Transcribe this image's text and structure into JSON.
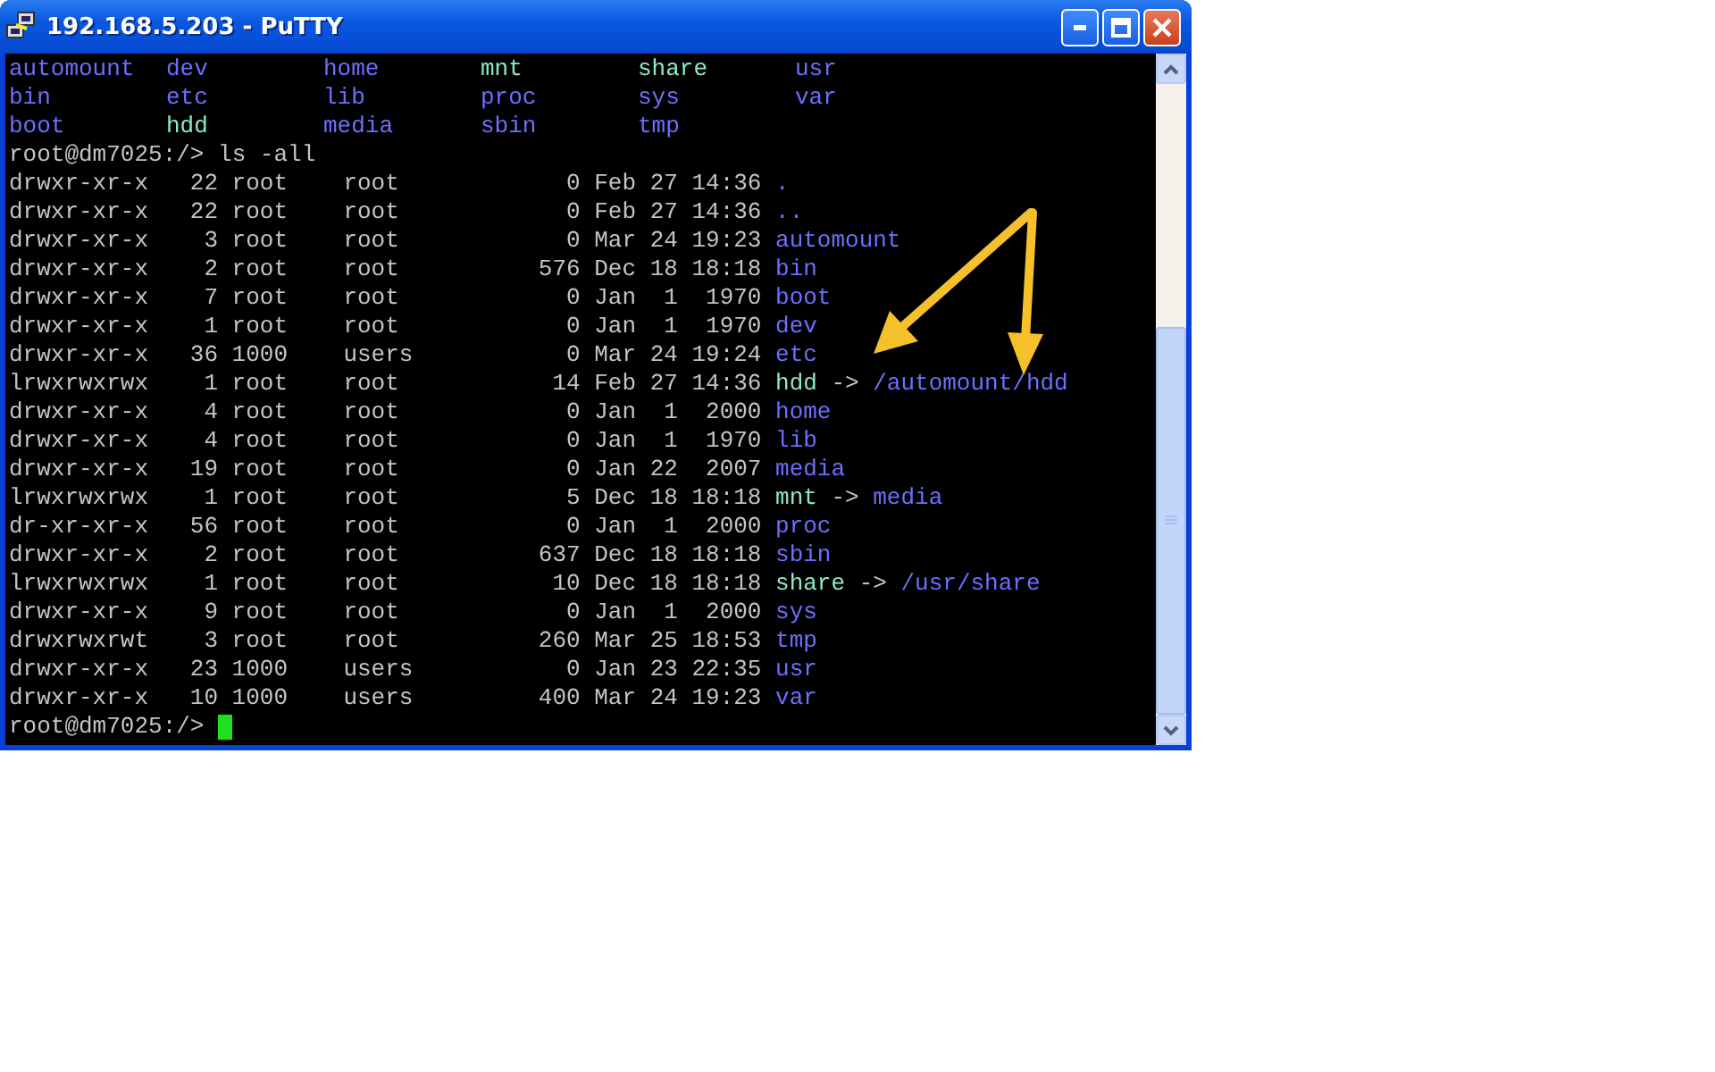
{
  "window": {
    "title": "192.168.5.203 - PuTTY"
  },
  "listing": [
    {
      "name": "automount",
      "kind": "dir"
    },
    {
      "name": "dev",
      "kind": "dir"
    },
    {
      "name": "home",
      "kind": "dir"
    },
    {
      "name": "mnt",
      "kind": "link"
    },
    {
      "name": "share",
      "kind": "link"
    },
    {
      "name": "usr",
      "kind": "dir"
    },
    {
      "name": "bin",
      "kind": "dir"
    },
    {
      "name": "etc",
      "kind": "dir"
    },
    {
      "name": "lib",
      "kind": "dir"
    },
    {
      "name": "proc",
      "kind": "dir"
    },
    {
      "name": "sys",
      "kind": "dir"
    },
    {
      "name": "var",
      "kind": "dir"
    },
    {
      "name": "boot",
      "kind": "dir"
    },
    {
      "name": "hdd",
      "kind": "link"
    },
    {
      "name": "media",
      "kind": "dir"
    },
    {
      "name": "sbin",
      "kind": "dir"
    },
    {
      "name": "tmp",
      "kind": "dir"
    }
  ],
  "command": {
    "prompt": "root@dm7025:/>",
    "text": "ls -all"
  },
  "entries": [
    {
      "perms": "drwxr-xr-x",
      "links": "22",
      "owner": "root",
      "group": "root",
      "size": "0",
      "date": "Feb 27 14:36",
      "name": ".",
      "kind": "dir"
    },
    {
      "perms": "drwxr-xr-x",
      "links": "22",
      "owner": "root",
      "group": "root",
      "size": "0",
      "date": "Feb 27 14:36",
      "name": "..",
      "kind": "dir"
    },
    {
      "perms": "drwxr-xr-x",
      "links": "3",
      "owner": "root",
      "group": "root",
      "size": "0",
      "date": "Mar 24 19:23",
      "name": "automount",
      "kind": "dir"
    },
    {
      "perms": "drwxr-xr-x",
      "links": "2",
      "owner": "root",
      "group": "root",
      "size": "576",
      "date": "Dec 18 18:18",
      "name": "bin",
      "kind": "dir"
    },
    {
      "perms": "drwxr-xr-x",
      "links": "7",
      "owner": "root",
      "group": "root",
      "size": "0",
      "date": "Jan  1  1970",
      "name": "boot",
      "kind": "dir"
    },
    {
      "perms": "drwxr-xr-x",
      "links": "1",
      "owner": "root",
      "group": "root",
      "size": "0",
      "date": "Jan  1  1970",
      "name": "dev",
      "kind": "dir"
    },
    {
      "perms": "drwxr-xr-x",
      "links": "36",
      "owner": "1000",
      "group": "users",
      "size": "0",
      "date": "Mar 24 19:24",
      "name": "etc",
      "kind": "dir"
    },
    {
      "perms": "lrwxrwxrwx",
      "links": "1",
      "owner": "root",
      "group": "root",
      "size": "14",
      "date": "Feb 27 14:36",
      "name": "hdd",
      "kind": "link",
      "arrow": "->",
      "target": "/automount/hdd"
    },
    {
      "perms": "drwxr-xr-x",
      "links": "4",
      "owner": "root",
      "group": "root",
      "size": "0",
      "date": "Jan  1  2000",
      "name": "home",
      "kind": "dir"
    },
    {
      "perms": "drwxr-xr-x",
      "links": "4",
      "owner": "root",
      "group": "root",
      "size": "0",
      "date": "Jan  1  1970",
      "name": "lib",
      "kind": "dir"
    },
    {
      "perms": "drwxr-xr-x",
      "links": "19",
      "owner": "root",
      "group": "root",
      "size": "0",
      "date": "Jan 22  2007",
      "name": "media",
      "kind": "dir"
    },
    {
      "perms": "lrwxrwxrwx",
      "links": "1",
      "owner": "root",
      "group": "root",
      "size": "5",
      "date": "Dec 18 18:18",
      "name": "mnt",
      "kind": "link",
      "arrow": "->",
      "target": "media"
    },
    {
      "perms": "dr-xr-xr-x",
      "links": "56",
      "owner": "root",
      "group": "root",
      "size": "0",
      "date": "Jan  1  2000",
      "name": "proc",
      "kind": "dir"
    },
    {
      "perms": "drwxr-xr-x",
      "links": "2",
      "owner": "root",
      "group": "root",
      "size": "637",
      "date": "Dec 18 18:18",
      "name": "sbin",
      "kind": "dir"
    },
    {
      "perms": "lrwxrwxrwx",
      "links": "1",
      "owner": "root",
      "group": "root",
      "size": "10",
      "date": "Dec 18 18:18",
      "name": "share",
      "kind": "link",
      "arrow": "->",
      "target": "/usr/share"
    },
    {
      "perms": "drwxr-xr-x",
      "links": "9",
      "owner": "root",
      "group": "root",
      "size": "0",
      "date": "Jan  1  2000",
      "name": "sys",
      "kind": "dir"
    },
    {
      "perms": "drwxrwxrwt",
      "links": "3",
      "owner": "root",
      "group": "root",
      "size": "260",
      "date": "Mar 25 18:53",
      "name": "tmp",
      "kind": "dir"
    },
    {
      "perms": "drwxr-xr-x",
      "links": "23",
      "owner": "1000",
      "group": "users",
      "size": "0",
      "date": "Jan 23 22:35",
      "name": "usr",
      "kind": "dir"
    },
    {
      "perms": "drwxr-xr-x",
      "links": "10",
      "owner": "1000",
      "group": "users",
      "size": "400",
      "date": "Mar 24 19:23",
      "name": "var",
      "kind": "dir"
    }
  ],
  "final_prompt": {
    "prompt": "root@dm7025:/>"
  }
}
